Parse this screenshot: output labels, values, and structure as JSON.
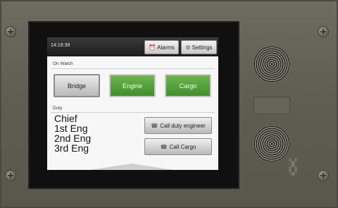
{
  "clock": "14:19:39",
  "header_buttons": {
    "alarms": {
      "label": "Alarms",
      "icon": "alarm-clock-icon"
    },
    "settings": {
      "label": "Settings",
      "icon": "gear-icon"
    }
  },
  "on_watch": {
    "title": "On Watch",
    "buttons": [
      {
        "label": "Bridge",
        "state": "inactive",
        "color": "#b9b9b9"
      },
      {
        "label": "Engine",
        "state": "active",
        "color": "#4f9e3a"
      },
      {
        "label": "Cargo",
        "state": "active",
        "color": "#4f9e3a"
      }
    ]
  },
  "duty": {
    "title": "Duty",
    "list": [
      "Chief",
      "1st Eng",
      "2nd Eng",
      "3rd Eng"
    ],
    "call_duty_engineer": {
      "label": "Call duty engineer",
      "icon": "person-phone-icon"
    },
    "call_cargo": {
      "label": "Call Cargo",
      "icon": "person-phone-icon"
    }
  }
}
